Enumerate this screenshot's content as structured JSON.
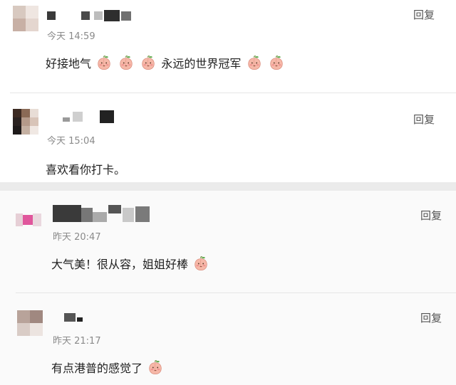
{
  "comments": [
    {
      "timestamp": "今天 14:59",
      "reply_label": "回复",
      "text_segments": [
        "好接地气",
        "永远的世界冠军"
      ],
      "emoji_icon": "peach-face-emoji"
    },
    {
      "timestamp": "今天 15:04",
      "reply_label": "回复",
      "text": "喜欢看你打卡。"
    },
    {
      "timestamp": "昨天 20:47",
      "reply_label": "回复",
      "text": "大气美！很从容，姐姐好棒",
      "emoji_icon": "peach-face-emoji"
    },
    {
      "timestamp": "昨天 21:17",
      "reply_label": "回复",
      "text": "有点港普的感觉了",
      "emoji_icon": "peach-face-emoji"
    }
  ],
  "colors": {
    "page_bg": "#ebebeb",
    "card_bg": "#ffffff",
    "timestamp": "#8a8a8a",
    "emoji_peach": "#f6b8a8",
    "emoji_leaf": "#5ea94a"
  }
}
